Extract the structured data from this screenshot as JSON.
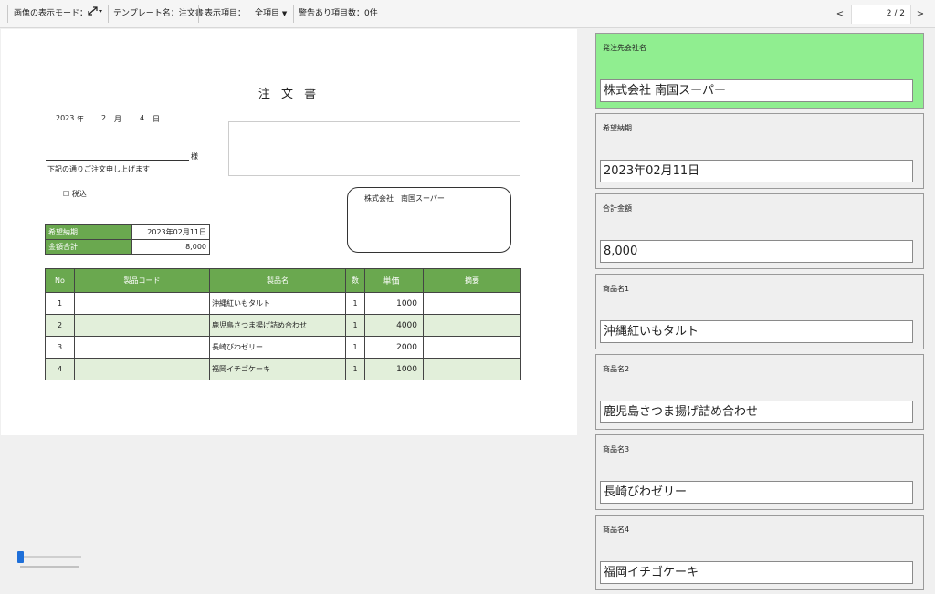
{
  "toolbar": {
    "display_mode_label": "画像の表示モード：",
    "display_mode_icon": "resize-arrows-icon",
    "template_label": "テンプレート名：注文書",
    "display_items_label": "表示項目：",
    "display_items_value": "全項目",
    "warning_count_label": "警告あり項目数：0件",
    "prev": "<",
    "next": ">",
    "page_indicator": "2 / 2"
  },
  "document": {
    "title": "注 文 書",
    "date": {
      "year": "2023",
      "year_unit": "年",
      "month": "2",
      "month_unit": "月",
      "day": "4",
      "day_unit": "日"
    },
    "honorific": "様",
    "intro": "下記の通りご注文申し上げます",
    "tax_included": "☐ 税込",
    "supplier": "株式会社　南国スーパー",
    "summary": [
      {
        "key": "希望納期",
        "value": "2023年02月11日"
      },
      {
        "key": "金額合計",
        "value": "8,000"
      }
    ],
    "table_headers": [
      "No",
      "製品コード",
      "製品名",
      "数",
      "単価",
      "摘要"
    ],
    "rows": [
      {
        "no": "1",
        "code": "",
        "name": "沖縄紅いもタルト",
        "qty": "1",
        "price": "1000",
        "memo": ""
      },
      {
        "no": "2",
        "code": "",
        "name": "鹿児島さつま揚げ詰め合わせ",
        "qty": "1",
        "price": "4000",
        "memo": ""
      },
      {
        "no": "3",
        "code": "",
        "name": "長崎びわゼリー",
        "qty": "1",
        "price": "2000",
        "memo": ""
      },
      {
        "no": "4",
        "code": "",
        "name": "福岡イチゴケーキ",
        "qty": "1",
        "price": "1000",
        "memo": ""
      }
    ]
  },
  "fields": [
    {
      "label": "発注先会社名",
      "value": "株式会社 南国スーパー",
      "active": true
    },
    {
      "label": "希望納期",
      "value": "2023年02月11日",
      "active": false
    },
    {
      "label": "合計金額",
      "value": "8,000",
      "active": false
    },
    {
      "label": "商品名1",
      "value": "沖縄紅いもタルト",
      "active": false
    },
    {
      "label": "商品名2",
      "value": "鹿児島さつま揚げ詰め合わせ",
      "active": false
    },
    {
      "label": "商品名3",
      "value": "長崎びわゼリー",
      "active": false
    },
    {
      "label": "商品名4",
      "value": "福岡イチゴケーキ",
      "active": false
    }
  ],
  "zoom_level": 0.05,
  "colors": {
    "accent_green": "#6aa84f",
    "active_field": "#90ee90",
    "row_alt": "#e2efda"
  }
}
